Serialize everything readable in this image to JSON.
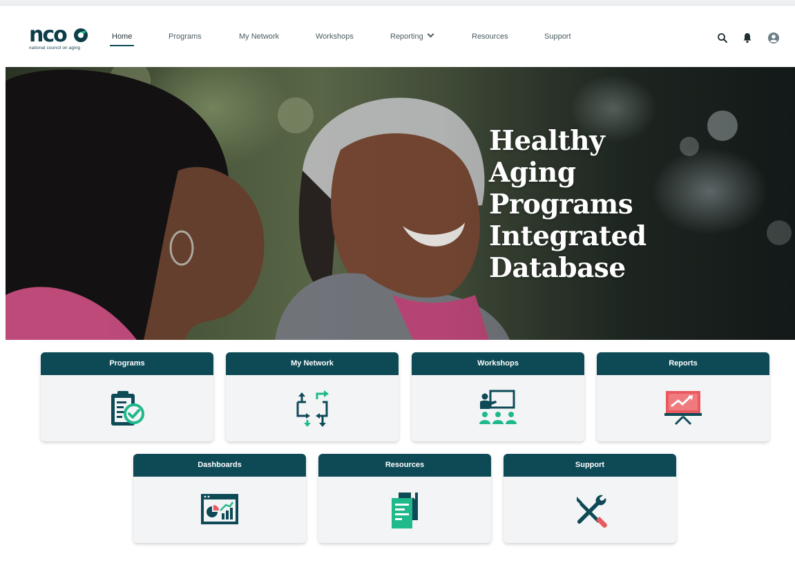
{
  "brand": {
    "logo_text": "nco",
    "logo_subtitle": "national council on aging"
  },
  "nav": {
    "items": [
      {
        "label": "Home",
        "active": true
      },
      {
        "label": "Programs"
      },
      {
        "label": "My Network"
      },
      {
        "label": "Workshops"
      },
      {
        "label": "Reporting",
        "has_dropdown": true
      },
      {
        "label": "Resources"
      },
      {
        "label": "Support"
      }
    ]
  },
  "header_icons": [
    "search-icon",
    "bell-icon",
    "user-avatar-icon"
  ],
  "hero": {
    "title_lines": [
      "Healthy",
      "Aging",
      "Programs",
      "Integrated",
      "Database"
    ]
  },
  "tiles": [
    {
      "label": "Programs",
      "icon": "clipboard-check-icon"
    },
    {
      "label": "My Network",
      "icon": "network-arrows-icon"
    },
    {
      "label": "Workshops",
      "icon": "presentation-group-icon"
    },
    {
      "label": "Reports",
      "icon": "chart-board-icon"
    },
    {
      "label": "Dashboards",
      "icon": "dashboard-window-icon"
    },
    {
      "label": "Resources",
      "icon": "documents-icon"
    },
    {
      "label": "Support",
      "icon": "tools-icon"
    }
  ],
  "colors": {
    "brand_dark": "#0d4a56",
    "accent_green": "#1fb98b",
    "accent_red": "#e85a5f"
  }
}
